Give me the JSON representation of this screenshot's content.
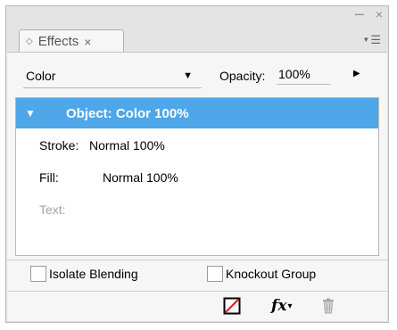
{
  "window": {
    "minimize_glyph": "–",
    "close_glyph": "×"
  },
  "tab": {
    "label": "Effects",
    "close_glyph": "×",
    "collapse_glyph": "◇"
  },
  "panel_menu": {
    "icon": "panel-menu-icon"
  },
  "blend_mode": {
    "selected": "Color"
  },
  "opacity": {
    "label": "Opacity:",
    "value": "100%"
  },
  "effects_list": {
    "object": "Object: Color 100%",
    "rows": [
      {
        "label": "Stroke:",
        "value": "Normal 100%",
        "enabled": true
      },
      {
        "label": "Fill:",
        "value": "Normal 100%",
        "enabled": true
      },
      {
        "label": "Text:",
        "value": "",
        "enabled": false
      }
    ]
  },
  "options": {
    "isolate_blending": {
      "label": "Isolate Blending",
      "checked": false
    },
    "knockout_group": {
      "label": "Knockout Group",
      "checked": false
    }
  },
  "footer_icons": [
    "clear-effects-icon",
    "fx-icon",
    "trash-icon"
  ],
  "colors": {
    "selection": "#4fa6e8",
    "clear_effects_red": "#e02020"
  }
}
